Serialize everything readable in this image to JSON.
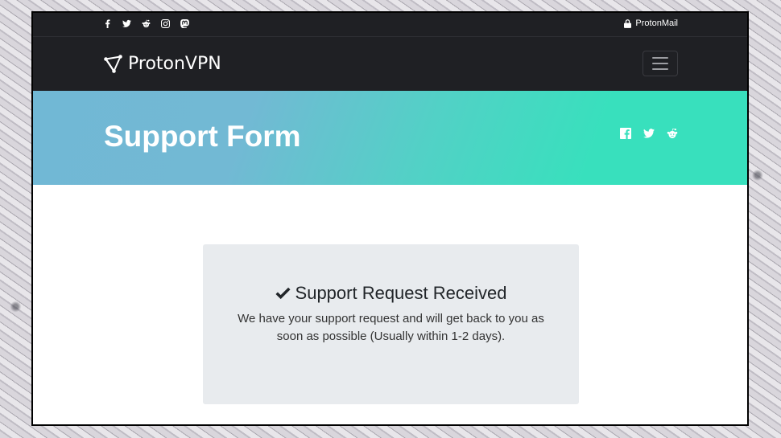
{
  "topbar": {
    "social_links": [
      {
        "name": "facebook",
        "icon": "facebook-icon"
      },
      {
        "name": "twitter",
        "icon": "twitter-icon"
      },
      {
        "name": "reddit",
        "icon": "reddit-icon"
      },
      {
        "name": "instagram",
        "icon": "instagram-icon"
      },
      {
        "name": "mastodon",
        "icon": "mastodon-icon"
      }
    ],
    "protonmail_label": "ProtonMail",
    "protonmail_icon": "lock-icon"
  },
  "navbar": {
    "brand_label": "ProtonVPN",
    "brand_icon": "protonvpn-logo-icon",
    "toggler_icon": "hamburger-menu-icon"
  },
  "hero": {
    "title": "Support Form",
    "share_links": [
      {
        "name": "facebook",
        "icon": "facebook-icon"
      },
      {
        "name": "twitter",
        "icon": "twitter-icon"
      },
      {
        "name": "reddit",
        "icon": "reddit-icon"
      }
    ]
  },
  "confirmation": {
    "icon": "checkmark-icon",
    "heading": "Support Request Received",
    "message": "We have your support request and will get back to you as soon as possible (Usually within 1-2 days)."
  },
  "colors": {
    "nav_bg": "#1f2024",
    "hero_gradient_start": "#71b8d5",
    "hero_gradient_end": "#38e0bd",
    "card_bg": "#e8ebee",
    "text_dark": "#212529"
  }
}
